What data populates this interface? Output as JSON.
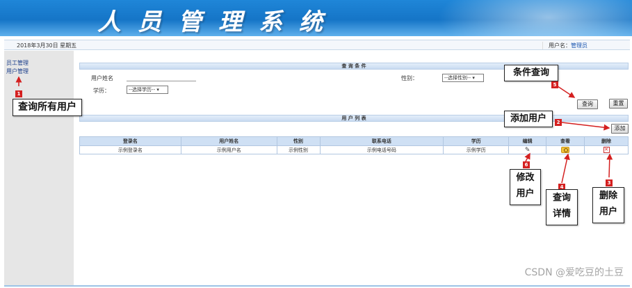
{
  "header": {
    "title": "人员管理系统"
  },
  "infobar": {
    "date": "2018年3月30日 星期五",
    "user_label": "用户名：",
    "user_name": "管理员"
  },
  "sidebar": {
    "items": [
      {
        "label": "员工管理"
      },
      {
        "label": "用户管理"
      }
    ]
  },
  "search": {
    "section_title": "查 询 条 件",
    "name_label": "用户姓名",
    "gender_label": "性别：",
    "gender_select": "--选择性别--",
    "edu_label": "学历：",
    "edu_select": "--选择学历--",
    "query_button": "查询",
    "reset_button": "重置"
  },
  "list": {
    "section_title": "用 户 列 表",
    "add_button": "添加",
    "columns": [
      "登录名",
      "用户姓名",
      "性别",
      "联系电话",
      "学历",
      "编辑",
      "查看",
      "删除"
    ],
    "rows": [
      {
        "login": "示例登录名",
        "name": "示例用户名",
        "gender": "示例性别",
        "phone": "示例电话号码",
        "edu": "示例学历"
      }
    ]
  },
  "annotations": {
    "a1": {
      "num": "1",
      "text": "查询所有用户"
    },
    "a2": {
      "num": "2",
      "text": "添加用户"
    },
    "a3": {
      "num": "3",
      "text": "删除\n用户"
    },
    "a4": {
      "num": "4",
      "text": "查询\n详情"
    },
    "a5": {
      "num": "5",
      "text": "条件查询"
    },
    "a6": {
      "num": "6",
      "text": "修改\n用户"
    }
  },
  "watermark": "CSDN @爱吃豆的土豆",
  "colors": {
    "banner": "#1575c7",
    "annotation_badge": "#d42020",
    "table_header": "#cfe0f4"
  }
}
